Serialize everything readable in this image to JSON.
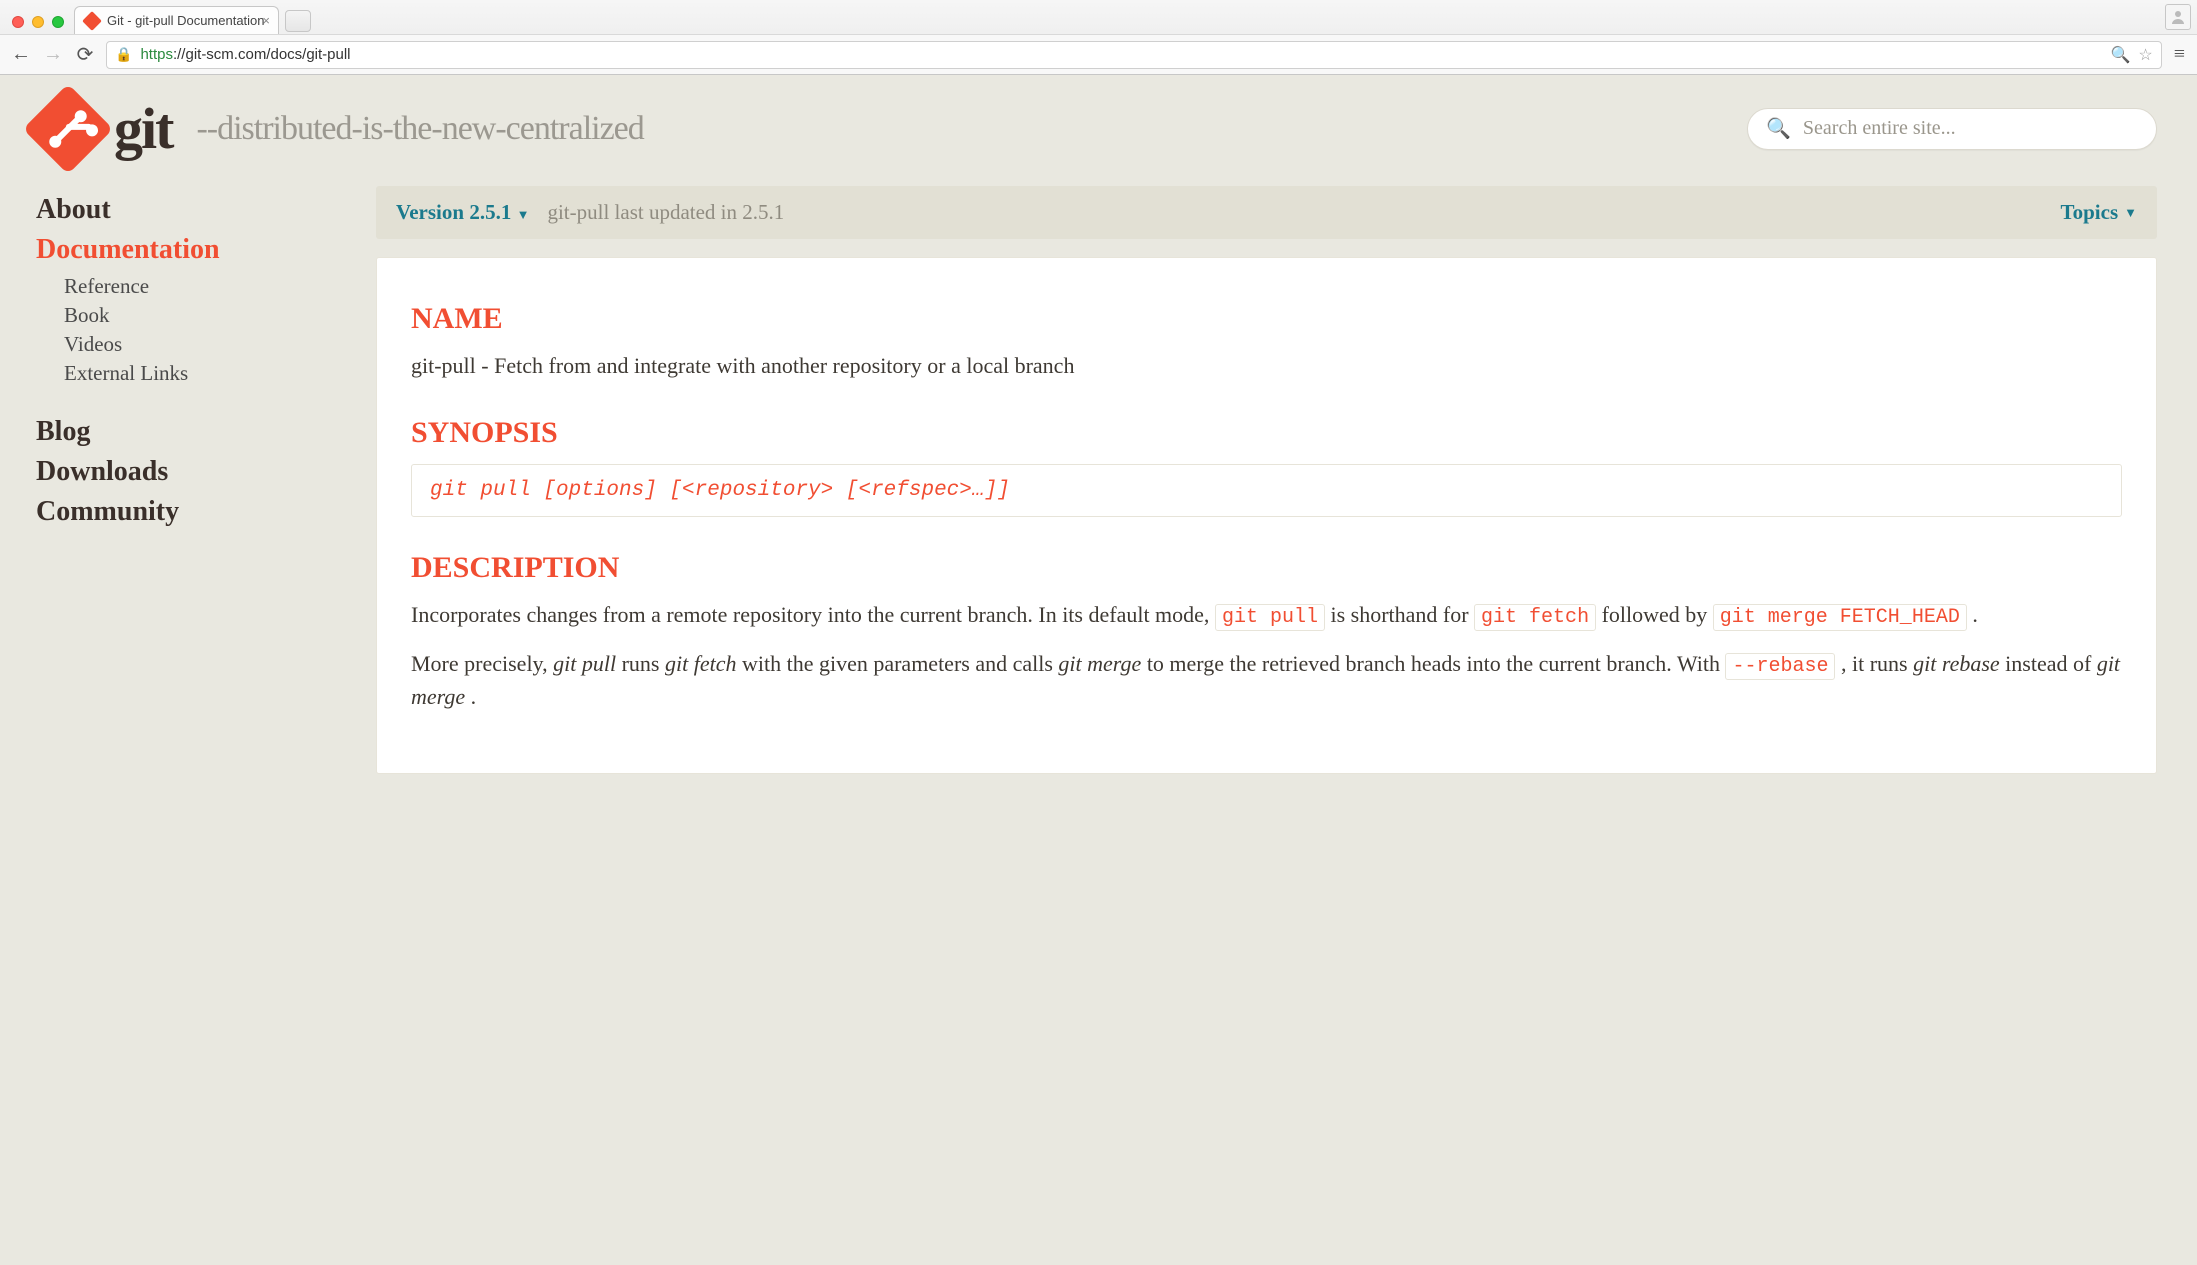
{
  "browser": {
    "tab_title": "Git - git-pull Documentation",
    "url_scheme": "https",
    "url_rest": "://git-scm.com/docs/git-pull"
  },
  "header": {
    "wordmark": "git",
    "tagline": "--distributed-is-the-new-centralized",
    "search_placeholder": "Search entire site..."
  },
  "sidebar": {
    "about": "About",
    "documentation": "Documentation",
    "sub": {
      "reference": "Reference",
      "book": "Book",
      "videos": "Videos",
      "external": "External Links"
    },
    "blog": "Blog",
    "downloads": "Downloads",
    "community": "Community"
  },
  "meta": {
    "version_label": "Version 2.5.1",
    "updated": "git-pull last updated in 2.5.1",
    "topics": "Topics"
  },
  "doc": {
    "h_name": "NAME",
    "name_text": "git-pull - Fetch from and integrate with another repository or a local branch",
    "h_synopsis": "SYNOPSIS",
    "synopsis_code": "git pull [options] [<repository> [<refspec>…]]",
    "h_description": "DESCRIPTION",
    "desc1_a": "Incorporates changes from a remote repository into the current branch. In its default mode, ",
    "desc1_code1": "git pull",
    "desc1_b": " is shorthand for ",
    "desc1_code2": "git fetch",
    "desc1_c": " followed by ",
    "desc1_code3": "git merge FETCH_HEAD",
    "desc1_d": " .",
    "desc2_a": "More precisely, ",
    "desc2_em1": "git pull",
    "desc2_b": " runs ",
    "desc2_em2": "git fetch",
    "desc2_c": " with the given parameters and calls ",
    "desc2_em3": "git merge",
    "desc2_d": " to merge the retrieved branch heads into the current branch. With ",
    "desc2_code1": "--rebase",
    "desc2_e": " , it runs ",
    "desc2_em4": "git rebase",
    "desc2_f": " instead of ",
    "desc2_em5": "git merge",
    "desc2_g": "."
  }
}
